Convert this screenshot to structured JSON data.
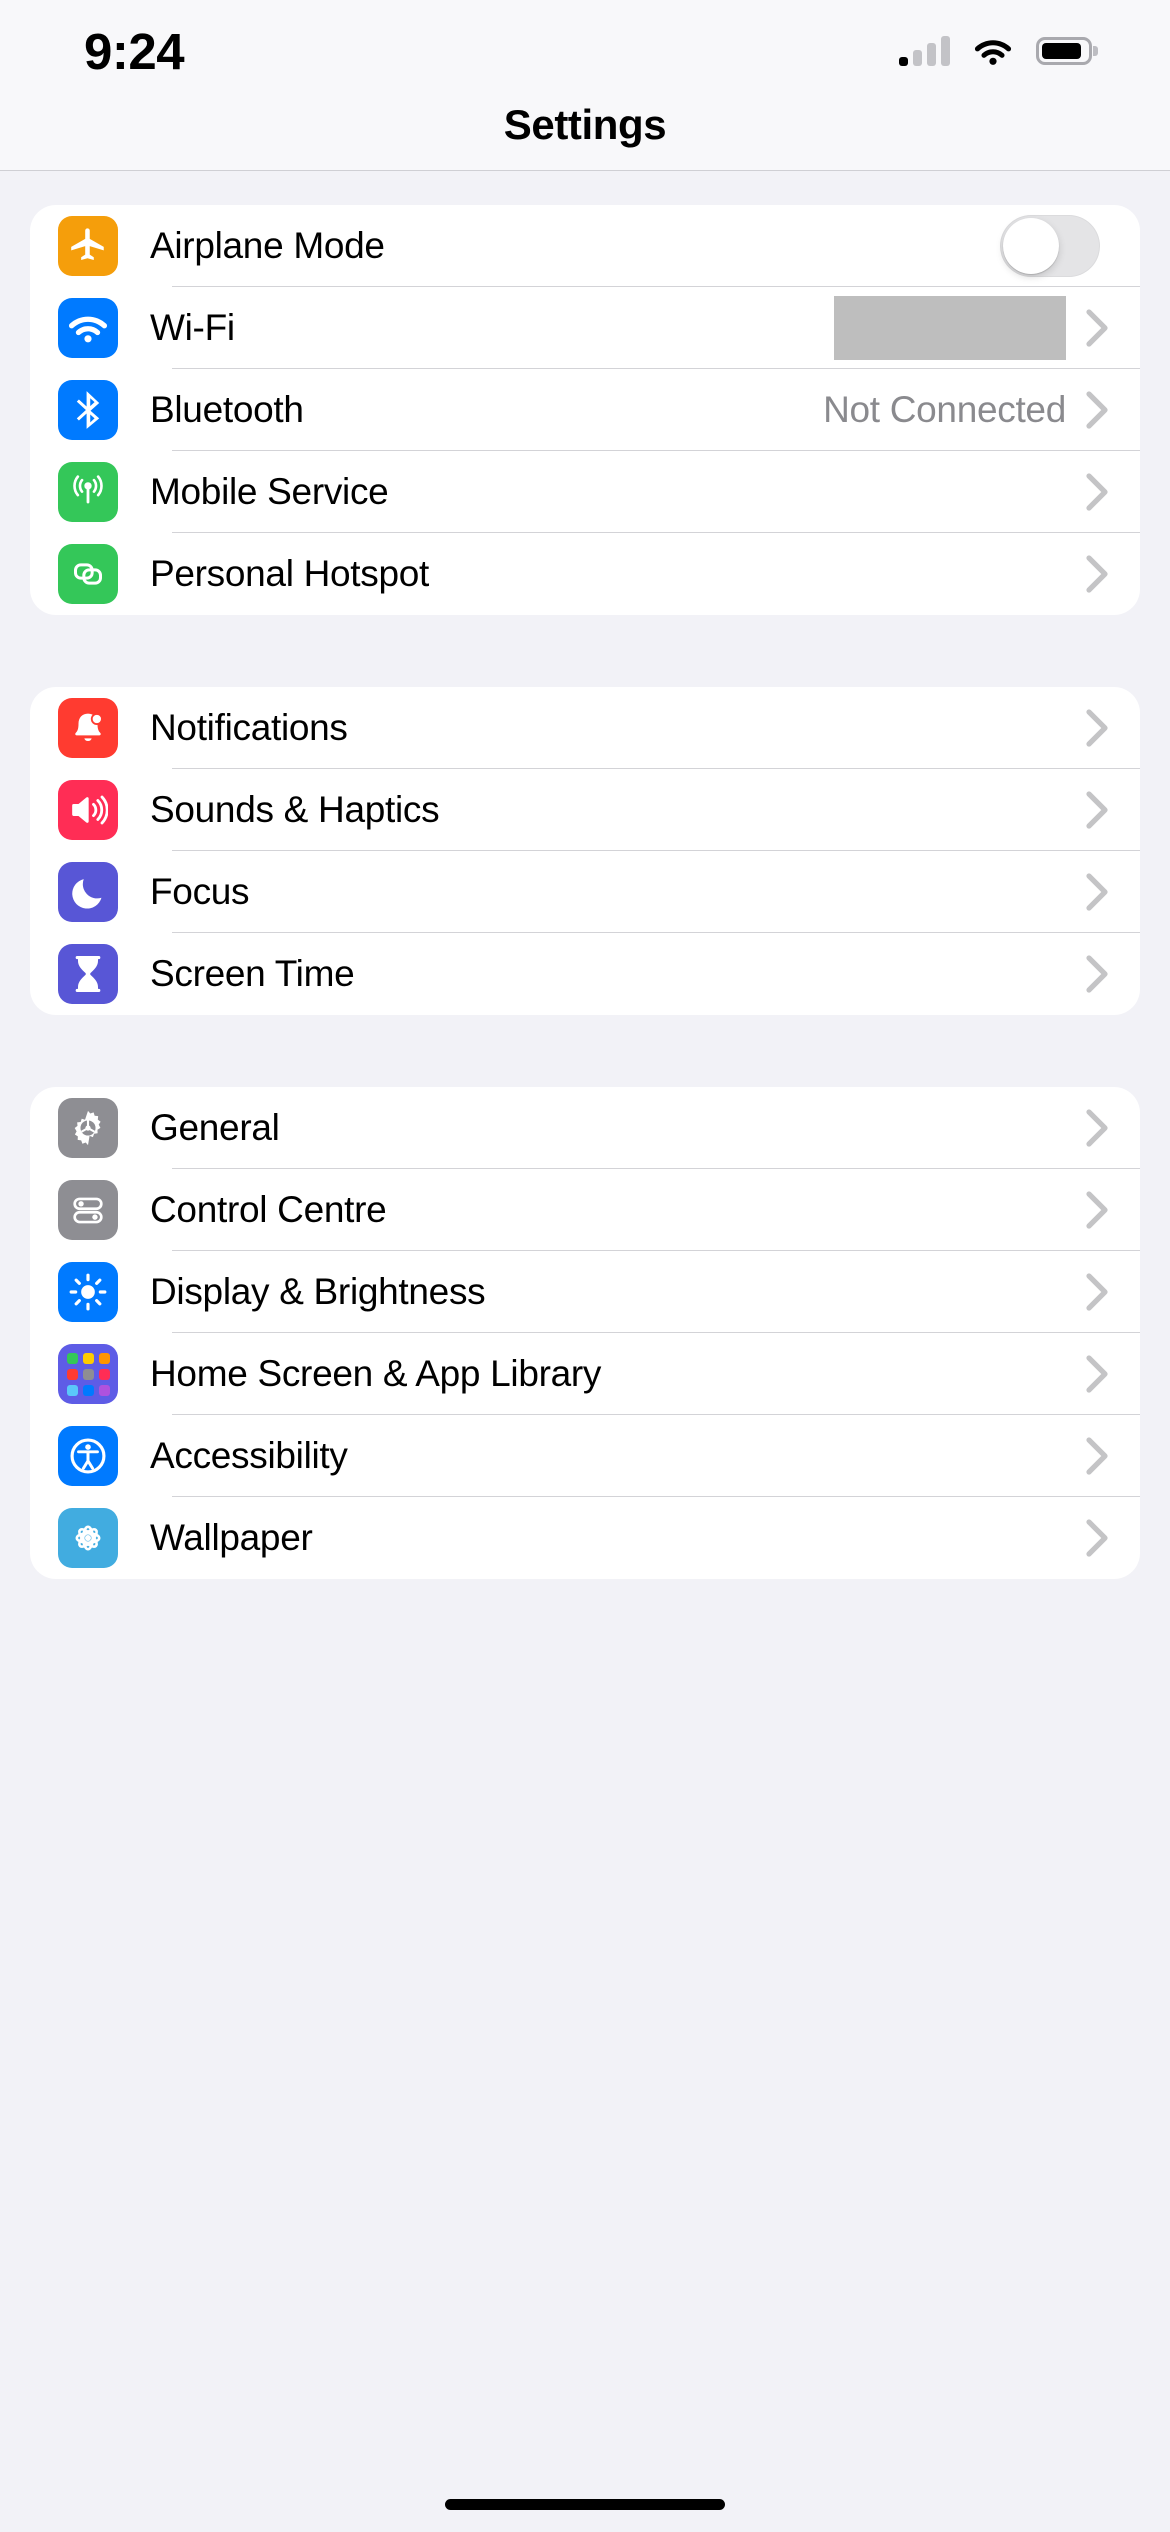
{
  "status_bar": {
    "time": "9:24",
    "cellular_icon": "cellular-signal-icon",
    "cellular_bars_total": 4,
    "cellular_bars_active": 1,
    "wifi_icon": "wifi-icon",
    "battery_icon": "battery-icon",
    "battery_fill_percent": 88
  },
  "nav": {
    "title": "Settings"
  },
  "groups": [
    {
      "id": "connectivity",
      "rows": [
        {
          "label": "Airplane Mode",
          "icon": "airplane-icon",
          "icon_bg": "#F59А0B",
          "accessory": "toggle",
          "toggle_on": false,
          "value": ""
        },
        {
          "label": "Wi-Fi",
          "icon": "wifi-icon",
          "icon_bg": "#007AFF",
          "accessory": "redacted-chevron",
          "value": ""
        },
        {
          "label": "Bluetooth",
          "icon": "bluetooth-icon",
          "icon_bg": "#007AFF",
          "accessory": "value-chevron",
          "value": "Not Connected"
        },
        {
          "label": "Mobile Service",
          "icon": "antenna-icon",
          "icon_bg": "#34C759",
          "accessory": "chevron",
          "value": ""
        },
        {
          "label": "Personal Hotspot",
          "icon": "hotspot-link-icon",
          "icon_bg": "#34C759",
          "accessory": "chevron",
          "value": ""
        }
      ]
    },
    {
      "id": "alerts",
      "rows": [
        {
          "label": "Notifications",
          "icon": "bell-badge-icon",
          "icon_bg": "#FF3B30",
          "accessory": "chevron",
          "value": ""
        },
        {
          "label": "Sounds & Haptics",
          "icon": "speaker-waves-icon",
          "icon_bg": "#FF2D55",
          "accessory": "chevron",
          "value": ""
        },
        {
          "label": "Focus",
          "icon": "moon-icon",
          "icon_bg": "#5856D6",
          "accessory": "chevron",
          "value": ""
        },
        {
          "label": "Screen Time",
          "icon": "hourglass-icon",
          "icon_bg": "#5856D6",
          "accessory": "chevron",
          "value": ""
        }
      ]
    },
    {
      "id": "system",
      "rows": [
        {
          "label": "General",
          "icon": "gear-icon",
          "icon_bg": "#8E8E93",
          "accessory": "chevron",
          "value": ""
        },
        {
          "label": "Control Centre",
          "icon": "control-sliders-icon",
          "icon_bg": "#8E8E93",
          "accessory": "chevron",
          "value": ""
        },
        {
          "label": "Display & Brightness",
          "icon": "sun-icon",
          "icon_bg": "#007AFF",
          "accessory": "chevron",
          "value": ""
        },
        {
          "label": "Home Screen & App Library",
          "icon": "app-grid-icon",
          "icon_bg": "#5E5CE6",
          "accessory": "chevron",
          "value": ""
        },
        {
          "label": "Accessibility",
          "icon": "accessibility-person-icon",
          "icon_bg": "#007AFF",
          "accessory": "chevron",
          "value": ""
        },
        {
          "label": "Wallpaper",
          "icon": "flower-icon",
          "icon_bg": "#41ACE0",
          "accessory": "chevron",
          "value": ""
        }
      ]
    }
  ],
  "colors": {
    "page_background": "#F2F2F7",
    "card_background": "#FFFFFF",
    "separator": "#D3D3D7",
    "secondary_text": "#8A8A8E",
    "redaction_block": "#BEBEBE",
    "chevron": "#C4C4C6",
    "home_indicator": "#000000"
  }
}
